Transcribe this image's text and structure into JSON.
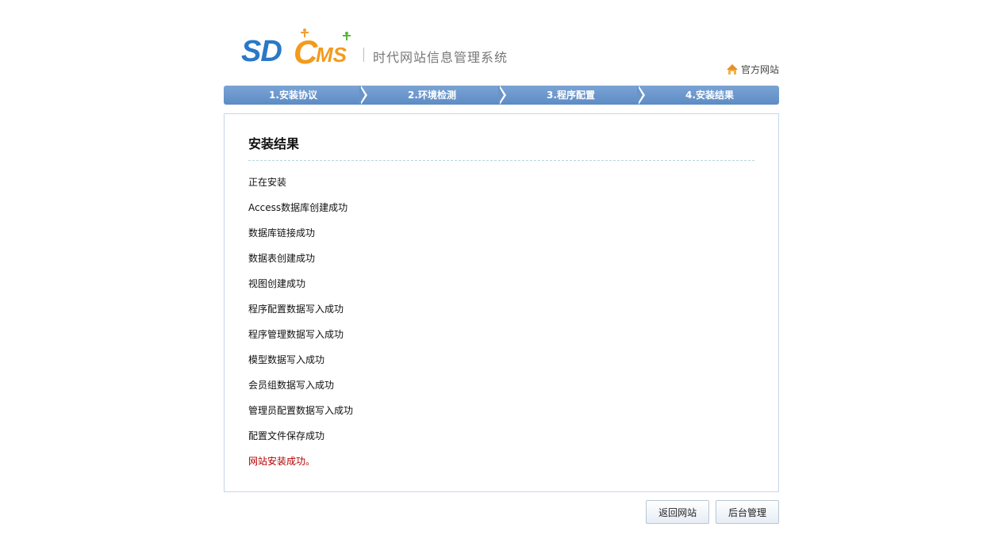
{
  "header": {
    "logo_sd": "SD",
    "logo_c": "C",
    "logo_ms": "MS",
    "tagline": "时代网站信息管理系统",
    "home_link": "官方网站"
  },
  "steps": [
    {
      "label": "1.安装协议"
    },
    {
      "label": "2.环境检测"
    },
    {
      "label": "3.程序配置"
    },
    {
      "label": "4.安装结果"
    }
  ],
  "main": {
    "title": "安装结果",
    "log": [
      "正在安装",
      "Access数据库创建成功",
      "数据库链接成功",
      "数据表创建成功",
      "视图创建成功",
      "程序配置数据写入成功",
      "程序管理数据写入成功",
      "模型数据写入成功",
      "会员组数据写入成功",
      "管理员配置数据写入成功",
      "配置文件保存成功"
    ],
    "success_message": "网站安装成功。"
  },
  "buttons": {
    "back_site": "返回网站",
    "admin": "后台管理"
  },
  "colors": {
    "step_bar": "#6894ca",
    "success_text": "#b30000",
    "box_border": "#c6d7e8"
  }
}
